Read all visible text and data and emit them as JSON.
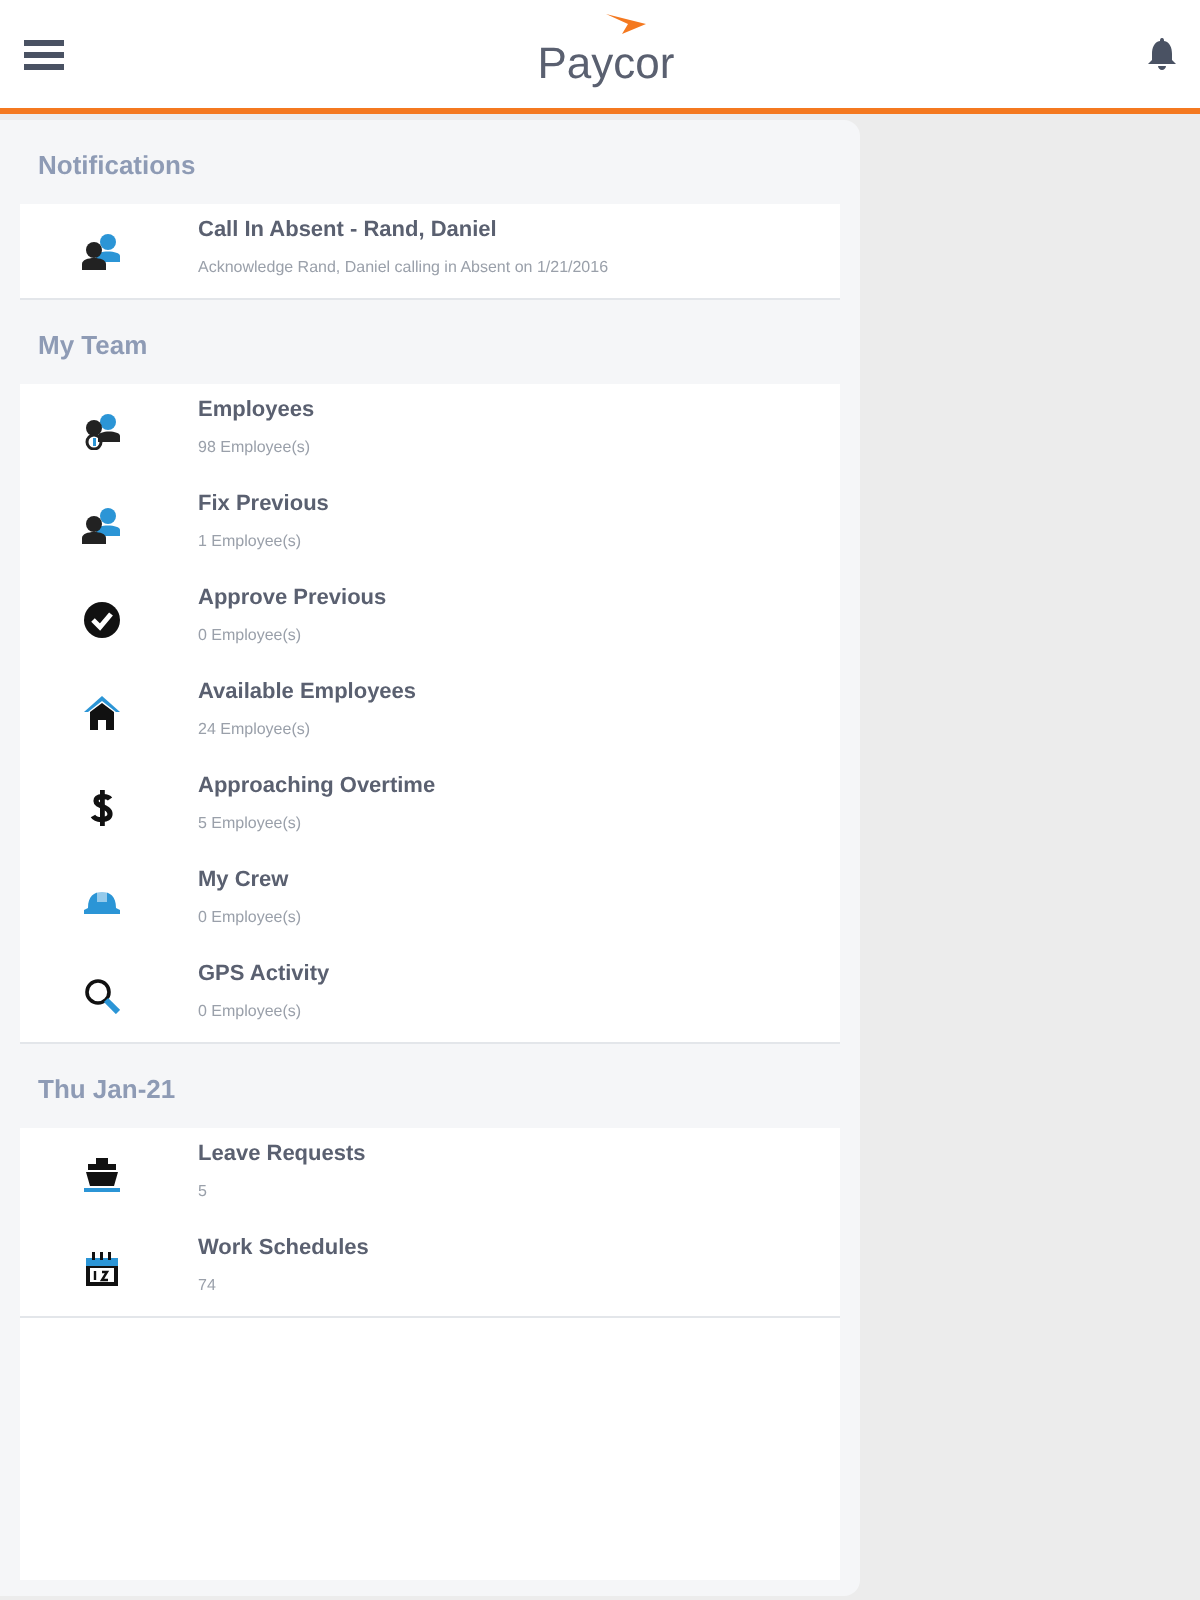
{
  "header": {
    "logo": "Paycor"
  },
  "sections": [
    {
      "title": "Notifications",
      "items": [
        {
          "title": "Call In Absent - Rand, Daniel",
          "subtitle": "Acknowledge Rand, Daniel calling in Absent on 1/21/2016"
        }
      ]
    },
    {
      "title": "My Team",
      "items": [
        {
          "title": "Employees",
          "subtitle": "98 Employee(s)"
        },
        {
          "title": "Fix Previous",
          "subtitle": "1 Employee(s)"
        },
        {
          "title": "Approve Previous",
          "subtitle": "0 Employee(s)"
        },
        {
          "title": "Available Employees",
          "subtitle": "24 Employee(s)"
        },
        {
          "title": "Approaching Overtime",
          "subtitle": "5 Employee(s)"
        },
        {
          "title": "My Crew",
          "subtitle": "0 Employee(s)"
        },
        {
          "title": "GPS Activity",
          "subtitle": "0 Employee(s)"
        }
      ]
    },
    {
      "title": "Thu Jan-21",
      "items": [
        {
          "title": "Leave Requests",
          "subtitle": "5"
        },
        {
          "title": "Work Schedules",
          "subtitle": "74"
        }
      ]
    }
  ]
}
